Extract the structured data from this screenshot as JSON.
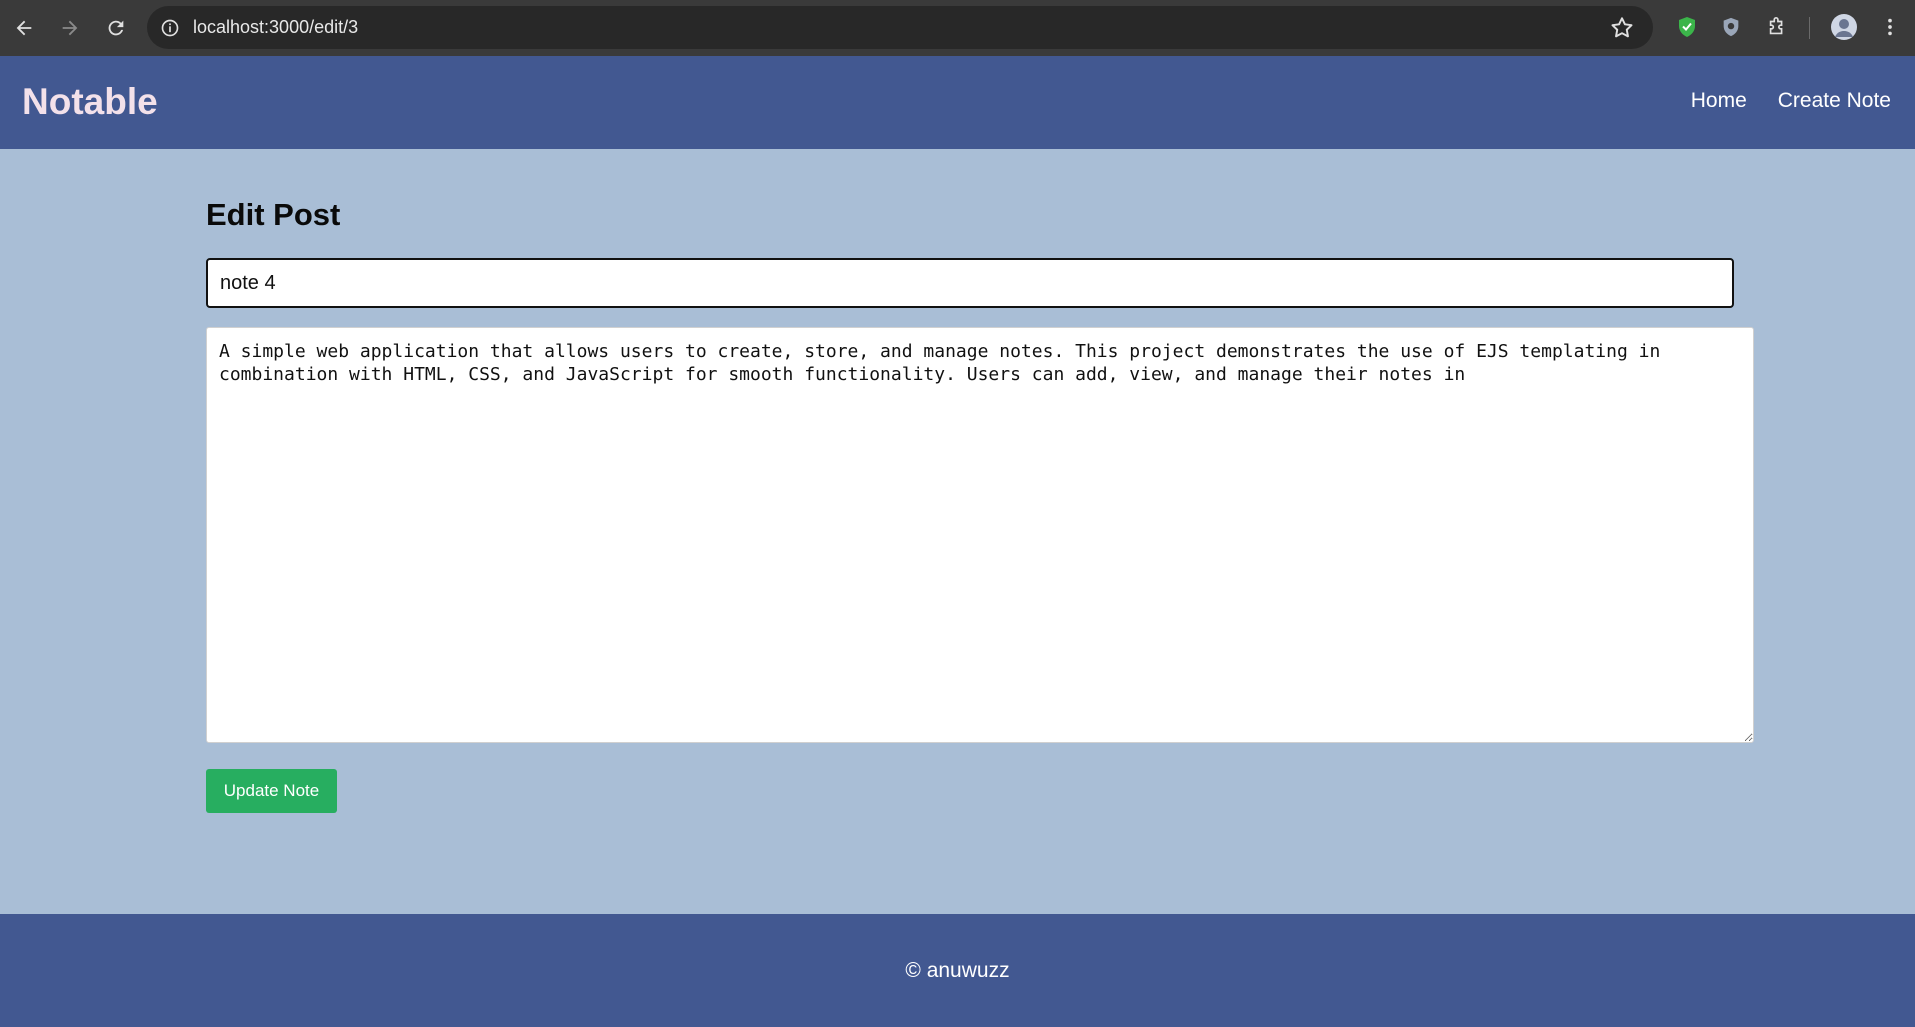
{
  "browser": {
    "url": "localhost:3000/edit/3"
  },
  "site": {
    "brand": "Notable",
    "nav": {
      "home": "Home",
      "create": "Create Note"
    },
    "colors": {
      "header": "#425891",
      "background": "#a9bed6",
      "button": "#27ae60"
    }
  },
  "form": {
    "heading": "Edit Post",
    "title_value": "note 4",
    "content_value": "A simple web application that allows users to create, store, and manage notes. This project demonstrates the use of EJS templating in combination with HTML, CSS, and JavaScript for smooth functionality. Users can add, view, and manage their notes in",
    "submit_label": "Update Note"
  },
  "footer": {
    "text": "© anuwuzz"
  }
}
